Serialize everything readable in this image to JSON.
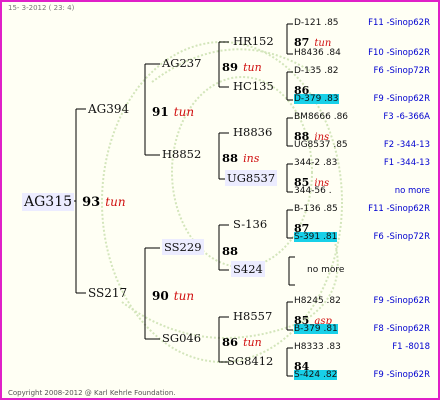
{
  "header": "15- 3-2012 ( 23: 4)",
  "footer": "Copyright 2008-2012 @ Karl Kehrle Foundation.",
  "colors": {
    "border": "#e020c8",
    "accent_red": "#d01010",
    "ref_blue": "#0000d0",
    "highlight_cyan": "#18d0e8"
  },
  "gen1": {
    "name": "AG315",
    "num": "93",
    "suffix": "tun"
  },
  "gen2": [
    {
      "name": "AG394",
      "num": "91",
      "suffix": "tun"
    },
    {
      "name": "SS217",
      "num": "90",
      "suffix": "tun"
    }
  ],
  "gen3": [
    {
      "name": "AG237",
      "num": "89",
      "suffix": "tun"
    },
    {
      "name": "H8852",
      "num": "88",
      "suffix": "ins"
    },
    {
      "name": "SS229",
      "num": "88",
      "suffix": ""
    },
    {
      "name": "SG046",
      "num": "86",
      "suffix": "tun"
    }
  ],
  "gen4": [
    {
      "name": "HR152"
    },
    {
      "name": "HC135"
    },
    {
      "name": "H8836"
    },
    {
      "name": "UG8537"
    },
    {
      "name": "S-136"
    },
    {
      "name": "S424"
    },
    {
      "name": "H8557"
    },
    {
      "name": "SG8412"
    }
  ],
  "gen5": [
    {
      "top": "D-121 .85",
      "num": "87",
      "suf": "tun",
      "bot": "H8436 .84",
      "ref_top": "F11 -Sinop62R",
      "ref_bot": "F10 -Sinop62R"
    },
    {
      "top": "D-135 .82",
      "num": "86",
      "suf": "",
      "bot": "D-379 .83",
      "ref_top": "F6 -Sinop72R",
      "ref_bot": "F9 -Sinop62R"
    },
    {
      "top": "BM8666 .86",
      "num": "88",
      "suf": "ins",
      "bot": "UG8537 .85",
      "ref_top": "F3 -6-366A",
      "ref_bot": "F2 -344-13"
    },
    {
      "top": "344-2 .83",
      "num": "85",
      "suf": "ins",
      "bot": "344-56 .",
      "ref_top": "F1 -344-13",
      "ref_bot": "no more"
    },
    {
      "top": "B-136 .85",
      "num": "87",
      "suf": "",
      "bot": "S-391 .81",
      "ref_top": "F11 -Sinop62R",
      "ref_bot": "F6 -Sinop72R"
    },
    {
      "top": "",
      "num": "",
      "suf": "",
      "bot": "",
      "ref_top": "",
      "ref_bot": "",
      "mid": "no more"
    },
    {
      "top": "H8245 .82",
      "num": "85",
      "suf": "asp",
      "bot": "B-379 .81",
      "ref_top": "F9 -Sinop62R",
      "ref_bot": "F8 -Sinop62R"
    },
    {
      "top": "H8333 .83",
      "num": "84",
      "suf": "",
      "bot": "S-424 .82",
      "ref_top": "F1 -8018",
      "ref_bot": "F9 -Sinop62R"
    }
  ]
}
